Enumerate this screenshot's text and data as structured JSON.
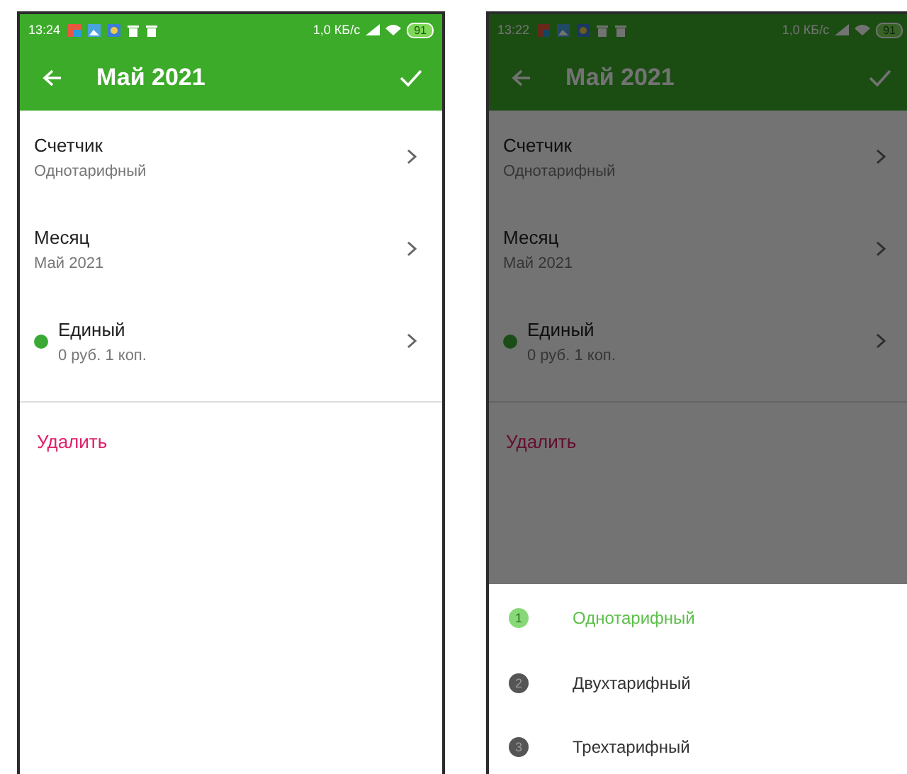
{
  "screens": [
    {
      "status_bar": {
        "time": "13:24",
        "speed": "1,0 КБ/с",
        "battery": "91"
      },
      "toolbar": {
        "title": "Май 2021"
      },
      "fields": [
        {
          "kind": "field",
          "label": "Счетчик",
          "value": "Однотарифный"
        },
        {
          "kind": "field",
          "label": "Месяц",
          "value": "Май 2021"
        },
        {
          "kind": "tariff",
          "label": "Единый",
          "value": "0 руб. 1 коп.",
          "color": "#3aaa35"
        }
      ],
      "delete_action": "Удалить",
      "dimmed": false
    },
    {
      "status_bar": {
        "time": "13:22",
        "speed": "1,0 КБ/с",
        "battery": "91"
      },
      "toolbar": {
        "title": "Май 2021"
      },
      "fields": [
        {
          "kind": "field",
          "label": "Счетчик",
          "value": "Однотарифный"
        },
        {
          "kind": "field",
          "label": "Месяц",
          "value": "Май 2021"
        },
        {
          "kind": "tariff",
          "label": "Единый",
          "value": "0 руб. 1 коп.",
          "color": "#1b4c18"
        }
      ],
      "delete_action": "Удалить",
      "dimmed": true,
      "sheet": {
        "options": [
          {
            "number": "1",
            "label": "Однотарифный",
            "selected": true
          },
          {
            "number": "2",
            "label": "Двухтарифный",
            "selected": false
          },
          {
            "number": "3",
            "label": "Трехтарифный",
            "selected": false
          }
        ]
      }
    }
  ]
}
